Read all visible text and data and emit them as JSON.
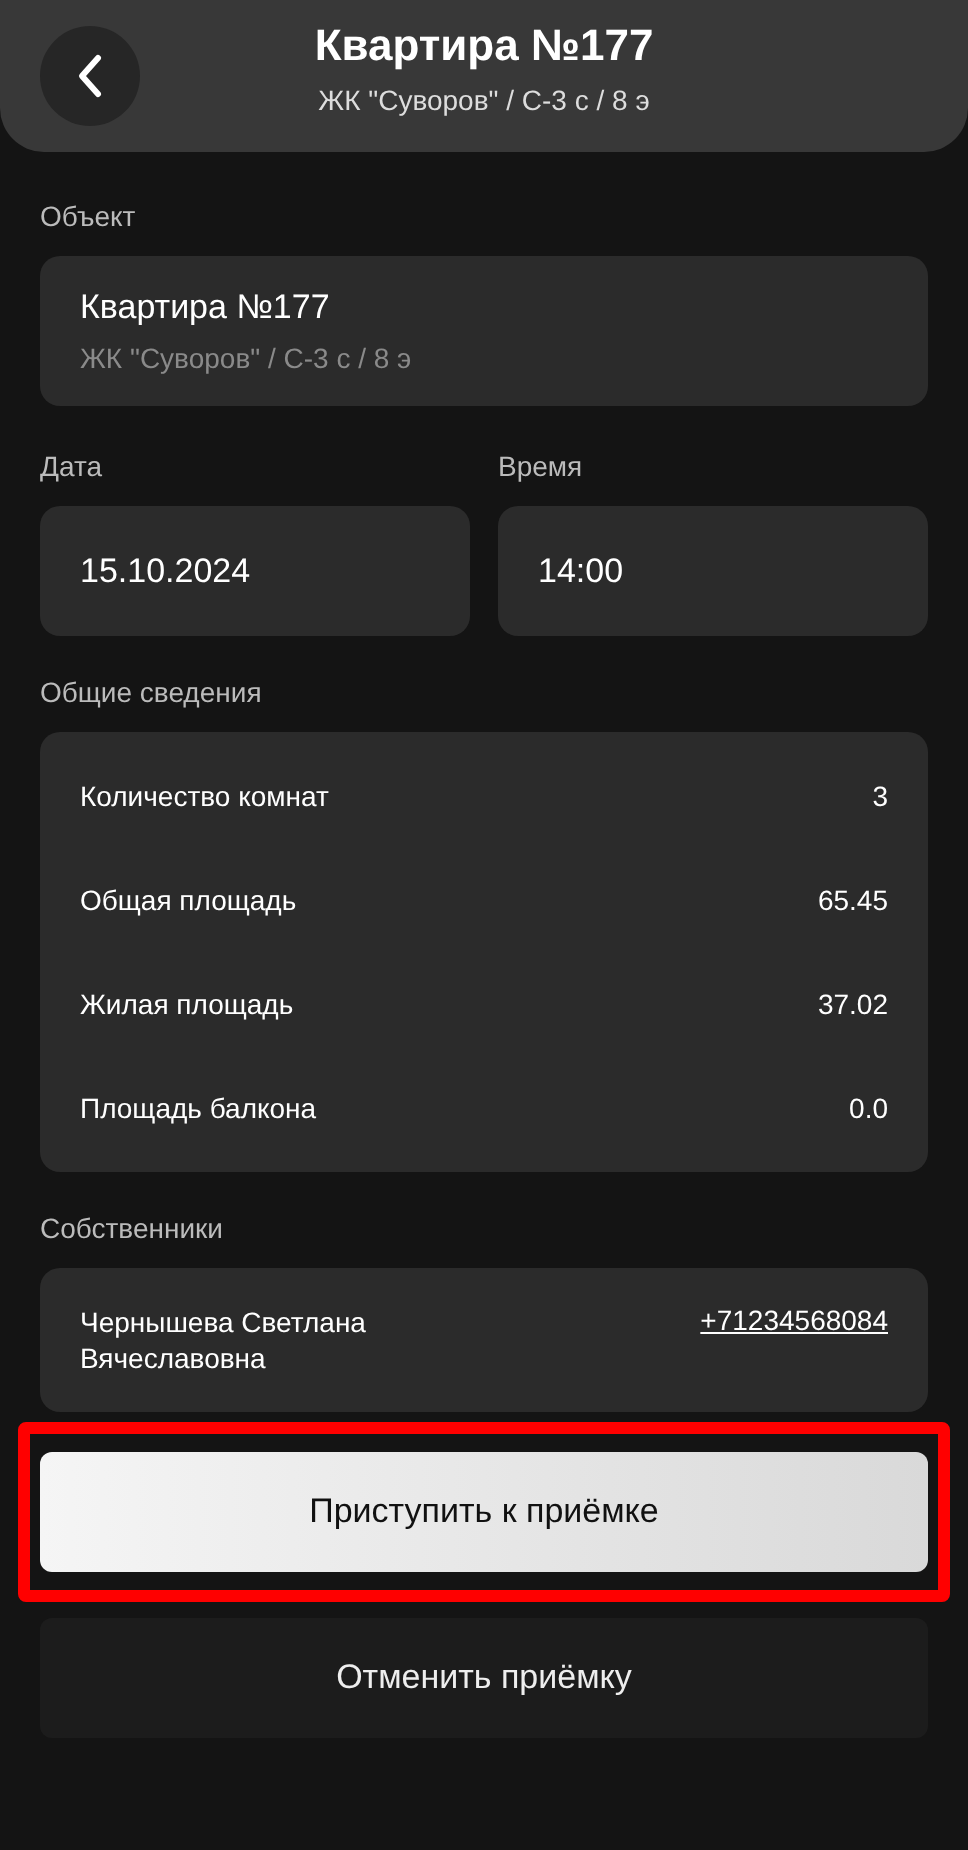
{
  "header": {
    "title": "Квартира №177",
    "subtitle": "ЖК \"Суворов\" / С-3 с / 8 э"
  },
  "object": {
    "label": "Объект",
    "title": "Квартира №177",
    "subtitle": "ЖК \"Суворов\" / С-3 с / 8 э"
  },
  "date": {
    "label": "Дата",
    "value": "15.10.2024"
  },
  "time": {
    "label": "Время",
    "value": "14:00"
  },
  "info": {
    "label": "Общие сведения",
    "rows": [
      {
        "name": "Количество комнат",
        "value": "3"
      },
      {
        "name": "Общая площадь",
        "value": "65.45"
      },
      {
        "name": "Жилая площадь",
        "value": "37.02"
      },
      {
        "name": "Площадь балкона",
        "value": "0.0"
      }
    ]
  },
  "owners": {
    "label": "Собственники",
    "items": [
      {
        "name": "Чернышева Светлана Вячеславовна",
        "phone": "+71234568084"
      }
    ]
  },
  "buttons": [
    {
      "label": "Приступить к приёмке",
      "kind": "primary",
      "highlighted": true
    },
    {
      "label": "Отменить приёмку",
      "kind": "secondary",
      "highlighted": false
    }
  ]
}
